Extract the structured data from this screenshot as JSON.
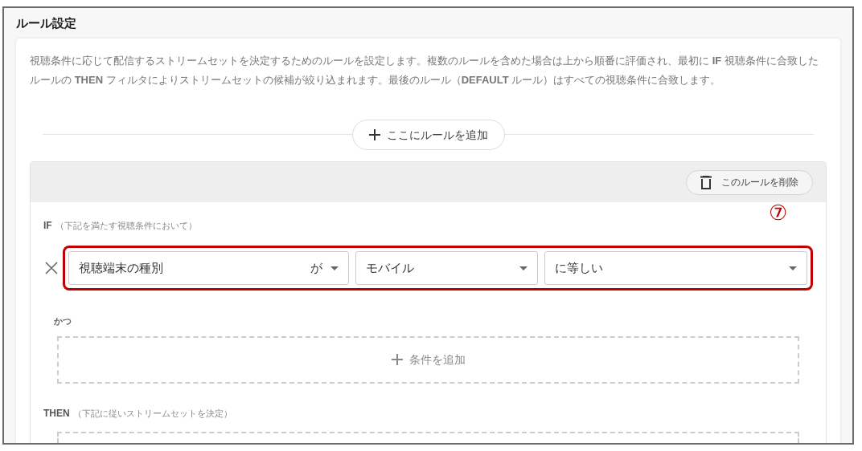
{
  "section_title": "ルール設定",
  "description": "視聴条件に応じて配信するストリームセットを決定するためのルールを設定します。複数のルールを含めた場合は上から順番に評価され、最初に **IF** 視聴条件に合致したルールの **THEN** フィルタによりストリームセットの候補が絞り込まれます。最後のルール（**DEFAULT** ルール）はすべての視聴条件に合致します。",
  "add_rule_button": "ここにルールを追加",
  "rule": {
    "delete_button": "このルールを削除",
    "if_label": "IF",
    "if_hint": "（下記を満たす視聴条件において）",
    "annotation": "⑦",
    "condition": {
      "attribute": "視聴端末の種別",
      "particle": "が",
      "value": "モバイル",
      "operator": "に等しい"
    },
    "and_label": "かつ",
    "add_condition_button": "条件を追加",
    "then_label": "THEN",
    "then_hint": "（下記に従いストリームセットを決定）"
  }
}
